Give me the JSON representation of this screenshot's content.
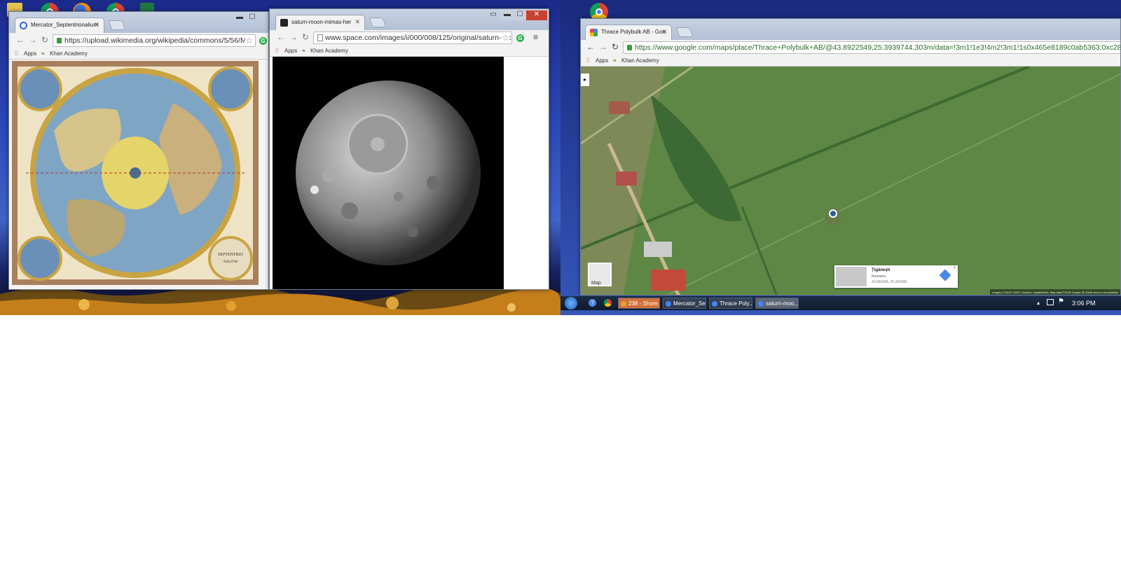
{
  "windows": {
    "mercator": {
      "tab_title": "Mercator_Septentrionalium",
      "url": "https://upload.wikimedia.org/wikipedia/commons/5/56/M",
      "bookmarks": {
        "apps": "Apps",
        "khan": "Khan Academy"
      },
      "map_caption": "SEPTENTRIONALIUM Terrarum descriptio"
    },
    "mimas": {
      "tab_title": "saturn-moon-mimas-her",
      "url": "www.space.com/images/i/000/008/125/original/saturn-mc",
      "bookmarks": {
        "apps": "Apps",
        "khan": "Khan Academy"
      }
    },
    "maps": {
      "tab_title": "Thrace Polybulk AB - Goo",
      "url": "https://www.google.com/maps/place/Thrace+Polybulk+AB/@43.8922549,25.3939744,303m/data=!3m1!1e3!4m2!3m1!1s0x465e8189c0ab5363:0xc28a64a38c",
      "bookmarks": {
        "apps": "Apps",
        "khan": "Khan Academy"
      },
      "map_button": "Map",
      "info_card": {
        "place": "Ţigăneşti",
        "country": "Romania",
        "coords": "43.891836, 25.392998"
      },
      "attribution": "Imagery ©2016 CNES / Astrium, DigitalGlobe, Map data ©2016 Google   3D Earth view is not available"
    }
  },
  "taskbar": {
    "items": [
      {
        "label": "238 - Shore...",
        "active": true
      },
      {
        "label": "Mercator_Se...",
        "active": false
      },
      {
        "label": "Thrace Poly...",
        "active": false
      },
      {
        "label": "saturn-moo...",
        "active": false
      }
    ],
    "clock": "3:06 PM"
  }
}
